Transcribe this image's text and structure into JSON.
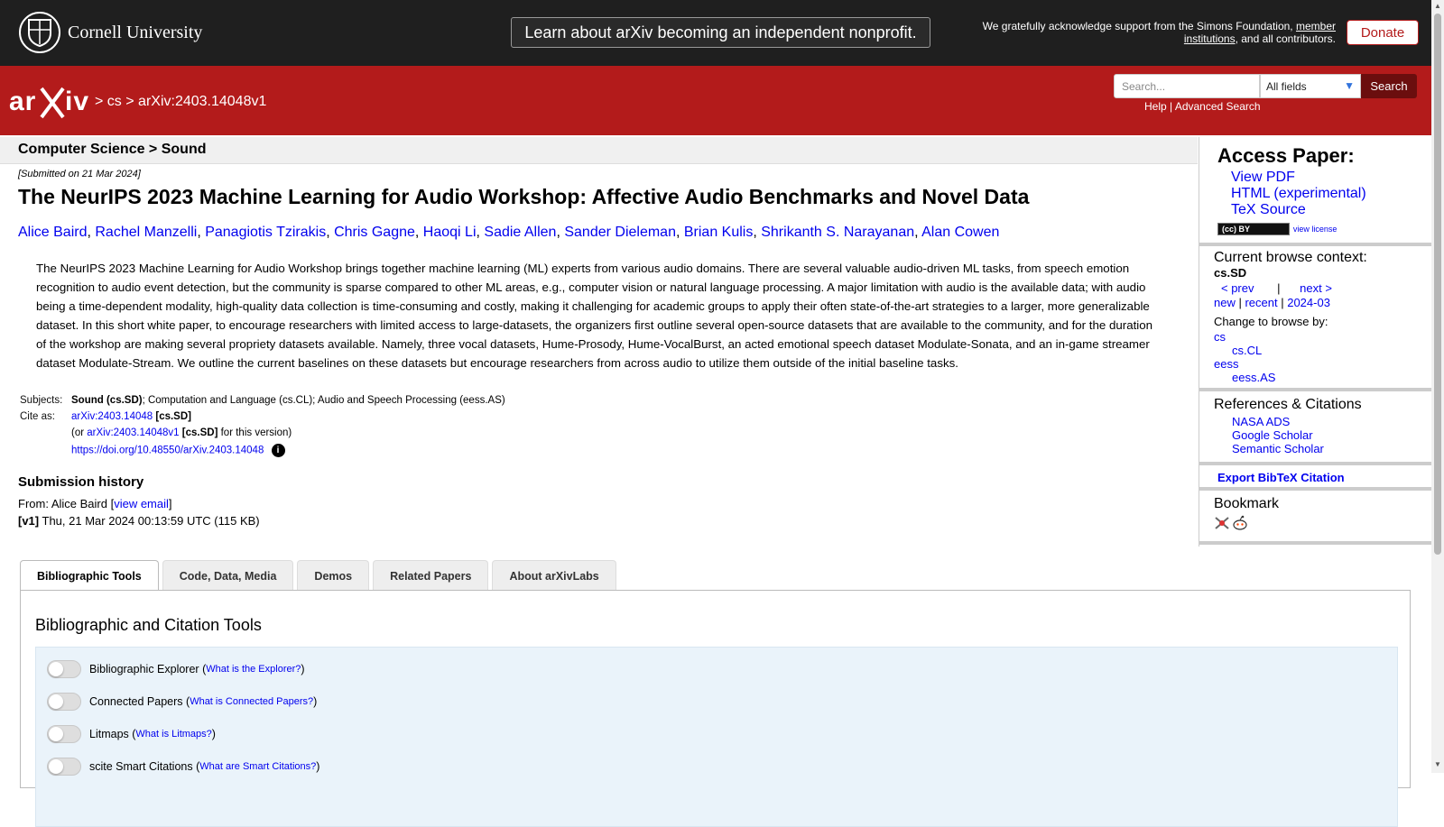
{
  "topbar": {
    "cornell_name": "Cornell University",
    "announcement": "Learn about arXiv becoming an independent nonprofit.",
    "support_prefix": "We gratefully acknowledge support from the Simons Foundation,",
    "support_link": "member institutions",
    "support_suffix": ", and all contributors.",
    "donate_label": "Donate"
  },
  "header": {
    "logo": "arXiv",
    "breadcrumb_sep1": ">",
    "breadcrumb_cs": "cs",
    "breadcrumb_sep2": ">",
    "breadcrumb_id": "arXiv:2403.14048v1",
    "search_placeholder": "Search...",
    "search_field": "All fields",
    "search_button": "Search",
    "help_link": "Help",
    "help_sep": "|",
    "advanced_link": "Advanced Search"
  },
  "paper": {
    "subject_heading": "Computer Science > Sound",
    "submitted": "[Submitted on 21 Mar 2024]",
    "title": "The NeurIPS 2023 Machine Learning for Audio Workshop: Affective Audio Benchmarks and Novel Data",
    "authors": [
      "Alice Baird",
      "Rachel Manzelli",
      "Panagiotis Tzirakis",
      "Chris Gagne",
      "Haoqi Li",
      "Sadie Allen",
      "Sander Dieleman",
      "Brian Kulis",
      "Shrikanth S. Narayanan",
      "Alan Cowen"
    ],
    "abstract": "The NeurIPS 2023 Machine Learning for Audio Workshop brings together machine learning (ML) experts from various audio domains. There are several valuable audio-driven ML tasks, from speech emotion recognition to audio event detection, but the community is sparse compared to other ML areas, e.g., computer vision or natural language processing. A major limitation with audio is the available data; with audio being a time-dependent modality, high-quality data collection is time-consuming and costly, making it challenging for academic groups to apply their often state-of-the-art strategies to a larger, more generalizable dataset. In this short white paper, to encourage researchers with limited access to large-datasets, the organizers first outline several open-source datasets that are available to the community, and for the duration of the workshop are making several propriety datasets available. Namely, three vocal datasets, Hume-Prosody, Hume-VocalBurst, an acted emotional speech dataset Modulate-Sonata, and an in-game streamer dataset Modulate-Stream. We outline the current baselines on these datasets but encourage researchers from across audio to utilize them outside of the initial baseline tasks.",
    "subjects_label": "Subjects:",
    "subjects_primary": "Sound (cs.SD)",
    "subjects_rest": "; Computation and Language (cs.CL); Audio and Speech Processing (eess.AS)",
    "cite_label": "Cite as:",
    "cite_id": "arXiv:2403.14048",
    "cite_cat": "[cs.SD]",
    "cite_or_prefix": "(or",
    "cite_version_id": "arXiv:2403.14048v1",
    "cite_version_cat": "[cs.SD]",
    "cite_version_suffix": "for this version)",
    "doi": "https://doi.org/10.48550/arXiv.2403.14048",
    "info_glyph": "i",
    "history_heading": "Submission history",
    "history_from_prefix": "From: Alice Baird [",
    "history_email_link": "view email",
    "history_from_suffix": "]",
    "history_v1_label": "[v1]",
    "history_v1_text": "Thu, 21 Mar 2024 00:13:59 UTC (115 KB)"
  },
  "sidebar": {
    "access_heading": "Access Paper:",
    "view_pdf": "View PDF",
    "html_experimental": "HTML (experimental)",
    "tex_source": "TeX Source",
    "cc_badge": "(cc) BY",
    "view_license": "view license",
    "browse_heading": "Current browse context:",
    "browse_context": "cs.SD",
    "prev": "< prev",
    "nav_sep": "|",
    "next": "next >",
    "new": "new",
    "recent": "recent",
    "month": "2024-03",
    "change_browse": "Change to browse by:",
    "browse_cs": "cs",
    "browse_cscl": "cs.CL",
    "browse_eess": "eess",
    "browse_eessas": "eess.AS",
    "refs_heading": "References & Citations",
    "nasa_ads": "NASA ADS",
    "google_scholar": "Google Scholar",
    "semantic_scholar": "Semantic Scholar",
    "export_bibtex": "Export BibTeX Citation",
    "bookmark_heading": "Bookmark"
  },
  "tabs": [
    "Bibliographic Tools",
    "Code, Data, Media",
    "Demos",
    "Related Papers",
    "About arXivLabs"
  ],
  "bib_tools": {
    "heading": "Bibliographic and Citation Tools",
    "rows": [
      {
        "label": "Bibliographic Explorer",
        "link": "What is the Explorer?"
      },
      {
        "label": "Connected Papers",
        "link": "What is Connected Papers?"
      },
      {
        "label": "Litmaps",
        "link": "What is Litmaps?"
      },
      {
        "label": "scite Smart Citations",
        "link": "What are Smart Citations?"
      }
    ]
  },
  "colors": {
    "arxiv_red": "#b31b1b",
    "topbar": "#1f1f1f",
    "link": "#0000ee"
  }
}
